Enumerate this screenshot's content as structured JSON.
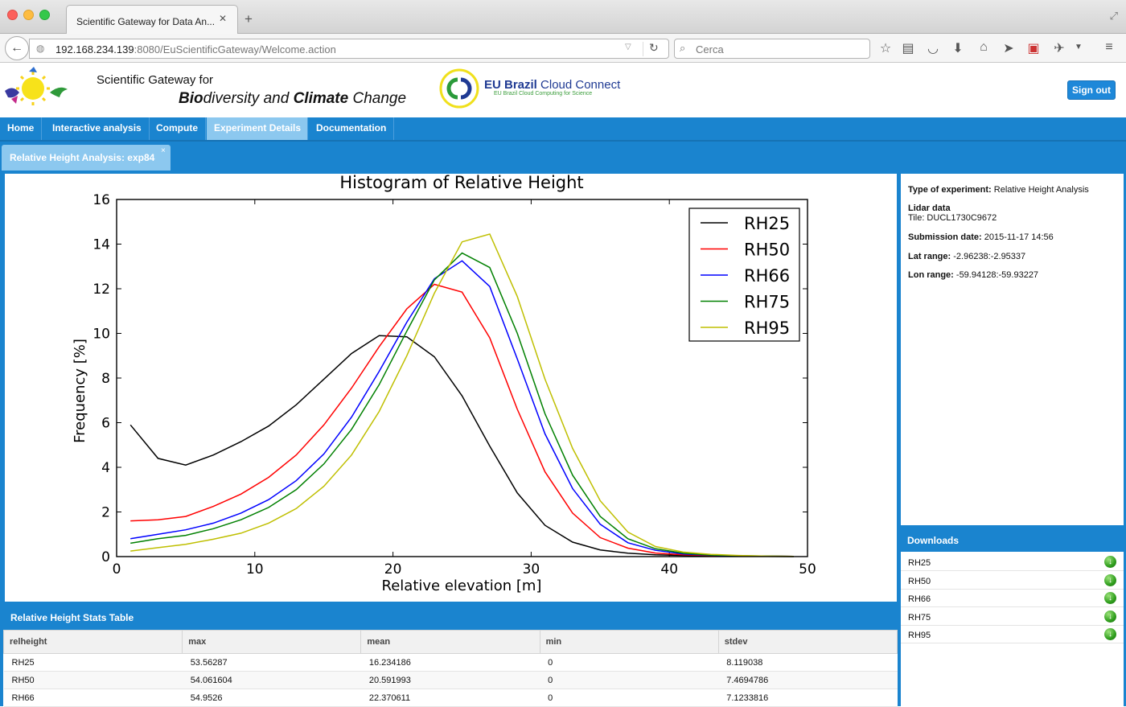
{
  "browser": {
    "tab_title": "Scientific Gateway for Data An...",
    "url_host": "192.168.234.139",
    "url_rest": ":8080/EuScientificGateway/Welcome.action",
    "search_placeholder": "Cerca"
  },
  "header": {
    "title_line1": "Scientific Gateway for",
    "title_line2_a": "Bio",
    "title_line2_b": "diversity and ",
    "title_line2_c": "Climate",
    "title_line2_d": " Change",
    "partner_name_bold": "EU Brazil",
    "partner_name_rest": " Cloud Connect",
    "partner_tagline": "EU Brazil Cloud Computing for Science",
    "signout_label": "Sign out"
  },
  "menu": {
    "items": [
      {
        "label": "Home"
      },
      {
        "label": "Interactive analysis"
      },
      {
        "label": "Compute"
      },
      {
        "label": "Experiment Details"
      },
      {
        "label": "Documentation"
      }
    ],
    "active": "Experiment Details"
  },
  "subtab": {
    "label": "Relative Height Analysis: exp84",
    "close": "×"
  },
  "experiment_info": {
    "type_label": "Type of experiment:",
    "type_value": "Relative Height Analysis",
    "lidar_label": "Lidar data",
    "tile_value": "Tile: DUCL1730C9672",
    "submission_label": "Submission date:",
    "submission_value": "2015-11-17 14:56",
    "lat_label": "Lat range:",
    "lat_value": "-2.96238:-2.95337",
    "lon_label": "Lon range:",
    "lon_value": "-59.94128:-59.93227"
  },
  "downloads": {
    "title": "Downloads",
    "items": [
      "RH25",
      "RH50",
      "RH66",
      "RH75",
      "RH95"
    ]
  },
  "stats_table": {
    "title": "Relative Height Stats Table",
    "columns": [
      "relheight",
      "max",
      "mean",
      "min",
      "stdev"
    ],
    "rows": [
      [
        "RH25",
        "53.56287",
        "16.234186",
        "0",
        "8.119038"
      ],
      [
        "RH50",
        "54.061604",
        "20.591993",
        "0",
        "7.4694786"
      ],
      [
        "RH66",
        "54.9526",
        "22.370611",
        "0",
        "7.1233816"
      ]
    ]
  },
  "chart_data": {
    "type": "line",
    "title": "Histogram of Relative Height",
    "xlabel": "Relative elevation [m]",
    "ylabel": "Frequency [%]",
    "xlim": [
      0,
      50
    ],
    "ylim": [
      0,
      16
    ],
    "xticks": [
      0,
      10,
      20,
      30,
      40,
      50
    ],
    "yticks": [
      0,
      2,
      4,
      6,
      8,
      10,
      12,
      14,
      16
    ],
    "legend_position": "top-right",
    "x": [
      1,
      3,
      5,
      7,
      9,
      11,
      13,
      15,
      17,
      19,
      21,
      23,
      25,
      27,
      29,
      31,
      33,
      35,
      37,
      39,
      41,
      43,
      45,
      47,
      49
    ],
    "series": [
      {
        "name": "RH25",
        "color": "#000000",
        "values": [
          5.9,
          4.4,
          4.1,
          4.55,
          5.15,
          5.85,
          6.8,
          7.95,
          9.1,
          9.9,
          9.85,
          8.95,
          7.2,
          4.95,
          2.85,
          1.4,
          0.65,
          0.3,
          0.15,
          0.08,
          0.05,
          0.03,
          0.02,
          0.01,
          0.0
        ]
      },
      {
        "name": "RH50",
        "color": "#ff0000",
        "values": [
          1.6,
          1.65,
          1.8,
          2.25,
          2.8,
          3.55,
          4.55,
          5.9,
          7.55,
          9.4,
          11.1,
          12.2,
          11.85,
          9.8,
          6.6,
          3.8,
          1.95,
          0.85,
          0.38,
          0.16,
          0.08,
          0.05,
          0.03,
          0.02,
          0.01
        ]
      },
      {
        "name": "RH66",
        "color": "#0000ff",
        "values": [
          0.8,
          1.0,
          1.2,
          1.5,
          1.95,
          2.55,
          3.4,
          4.6,
          6.25,
          8.3,
          10.5,
          12.45,
          13.25,
          12.1,
          8.85,
          5.5,
          3.05,
          1.45,
          0.62,
          0.28,
          0.12,
          0.06,
          0.03,
          0.02,
          0.01
        ]
      },
      {
        "name": "RH75",
        "color": "#008000",
        "values": [
          0.6,
          0.8,
          0.95,
          1.25,
          1.65,
          2.2,
          3.0,
          4.15,
          5.7,
          7.7,
          10.1,
          12.4,
          13.6,
          12.95,
          10.0,
          6.4,
          3.65,
          1.8,
          0.8,
          0.35,
          0.15,
          0.07,
          0.04,
          0.02,
          0.01
        ]
      },
      {
        "name": "RH95",
        "color": "#bfbf00",
        "values": [
          0.25,
          0.4,
          0.55,
          0.78,
          1.05,
          1.5,
          2.15,
          3.15,
          4.55,
          6.5,
          9.0,
          11.8,
          14.1,
          14.45,
          11.65,
          7.95,
          4.85,
          2.5,
          1.1,
          0.45,
          0.2,
          0.1,
          0.05,
          0.02,
          0.01
        ]
      }
    ]
  }
}
